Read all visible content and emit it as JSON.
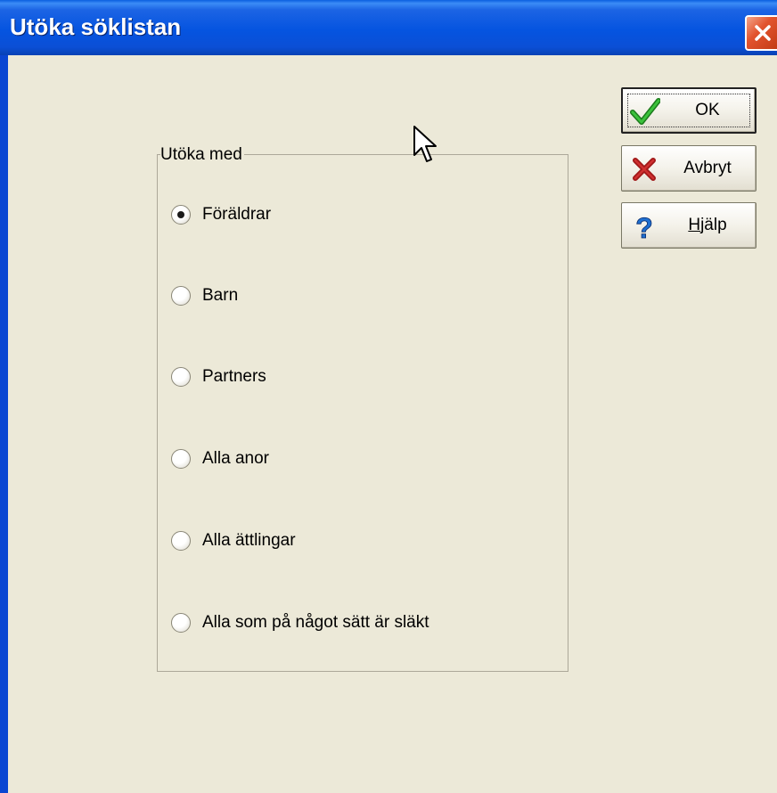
{
  "window": {
    "title": "Utöka söklistan"
  },
  "groupbox": {
    "label": "Utöka med"
  },
  "options": [
    {
      "label": "Föräldrar",
      "selected": true
    },
    {
      "label": "Barn",
      "selected": false
    },
    {
      "label": "Partners",
      "selected": false
    },
    {
      "label": "Alla anor",
      "selected": false
    },
    {
      "label": "Alla ättlingar",
      "selected": false
    },
    {
      "label": "Alla som på något sätt är släkt",
      "selected": false
    }
  ],
  "buttons": {
    "ok": {
      "label": "OK",
      "icon": "checkmark-icon"
    },
    "cancel": {
      "label": "Avbryt",
      "icon": "red-x-icon"
    },
    "help": {
      "label_first": "H",
      "label_rest": "jälp",
      "icon": "question-mark-icon"
    }
  },
  "colors": {
    "titlebar": "#0554e0",
    "dialog_bg": "#ece9d8",
    "ok_check": "#2ca02c",
    "cancel_x": "#a01818",
    "help_q": "#1f6fd0",
    "close": "#e2542e"
  }
}
